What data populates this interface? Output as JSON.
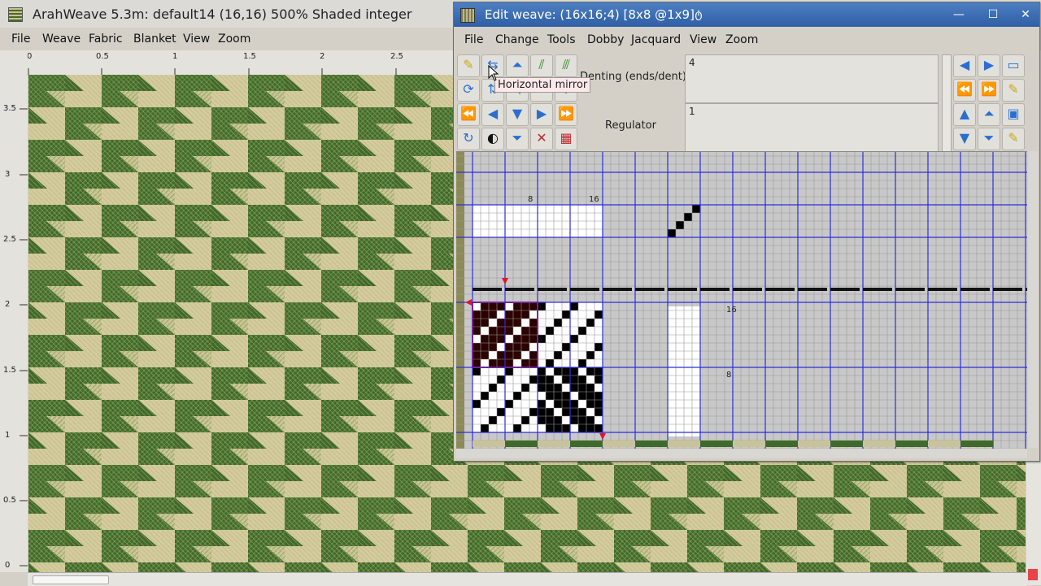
{
  "main": {
    "title": "ArahWeave 5.3m: default14 (16,16) 500% Shaded integer",
    "menu": [
      "File",
      "Weave",
      "Fabric",
      "Blanket",
      "View",
      "Zoom"
    ],
    "ruler_top": {
      "unit": "cm",
      "labels": [
        "0",
        "0.5",
        "1",
        "1.5",
        "2",
        "2.5"
      ]
    },
    "ruler_left": {
      "labels": [
        "3.5",
        "3",
        "2.5",
        "2",
        "1.5",
        "1",
        "0.5",
        "0"
      ]
    },
    "fabric_colors": {
      "dark": "#3f6a2a",
      "mid": "#5b8a3a",
      "light": "#cfc79a",
      "lighter": "#e0d9b0"
    }
  },
  "edit_weave": {
    "title": "Edit weave:  (16x16;4) [8x8 @1x9]",
    "menu": [
      "File",
      "Change",
      "Tools",
      "Dobby",
      "Jacquard",
      "View",
      "Zoom"
    ],
    "tooltip": "Horizontal mirror",
    "denting_label": "Denting (ends/dent)",
    "denting_value": "4",
    "regulator_label": "Regulator",
    "regulator_value": "1",
    "grid_labels": {
      "top_8": "8",
      "top_16": "16",
      "right_16": "16",
      "right_8": "8"
    },
    "colors": {
      "grid_line": "#2e2ed8",
      "cell_bg": "#c8c8c8",
      "red": "#e0142c",
      "accent": "#2f5fa6"
    },
    "left_toolbar_icons": [
      "brush-yellow-icon",
      "horizontal-mirror-icon",
      "shift-up-icon",
      "diagonal-twill-icon",
      "diagonal-twill-reverse-icon",
      "rotate-icon",
      "mirror-vertical-icon",
      "mirror-icon",
      "flip-icon",
      "flip-green-icon",
      "skip-left-icon",
      "arrow-left-icon",
      "arrow-down-icon",
      "arrow-right-icon",
      "skip-right-icon",
      "refresh-icon",
      "invert-icon",
      "shift-down-icon",
      "clear-weave-icon",
      "pattern-icon"
    ],
    "right_toolbar_icons": [
      "arrow-left-icon",
      "arrow-right-icon",
      "page-icon",
      "skip-left-icon",
      "skip-right-icon",
      "brush-yellow-icon",
      "arrow-up-icon",
      "shift-up-icon",
      "page-up-icon",
      "arrow-down-icon",
      "shift-down-icon",
      "brush-yellow-icon"
    ]
  }
}
